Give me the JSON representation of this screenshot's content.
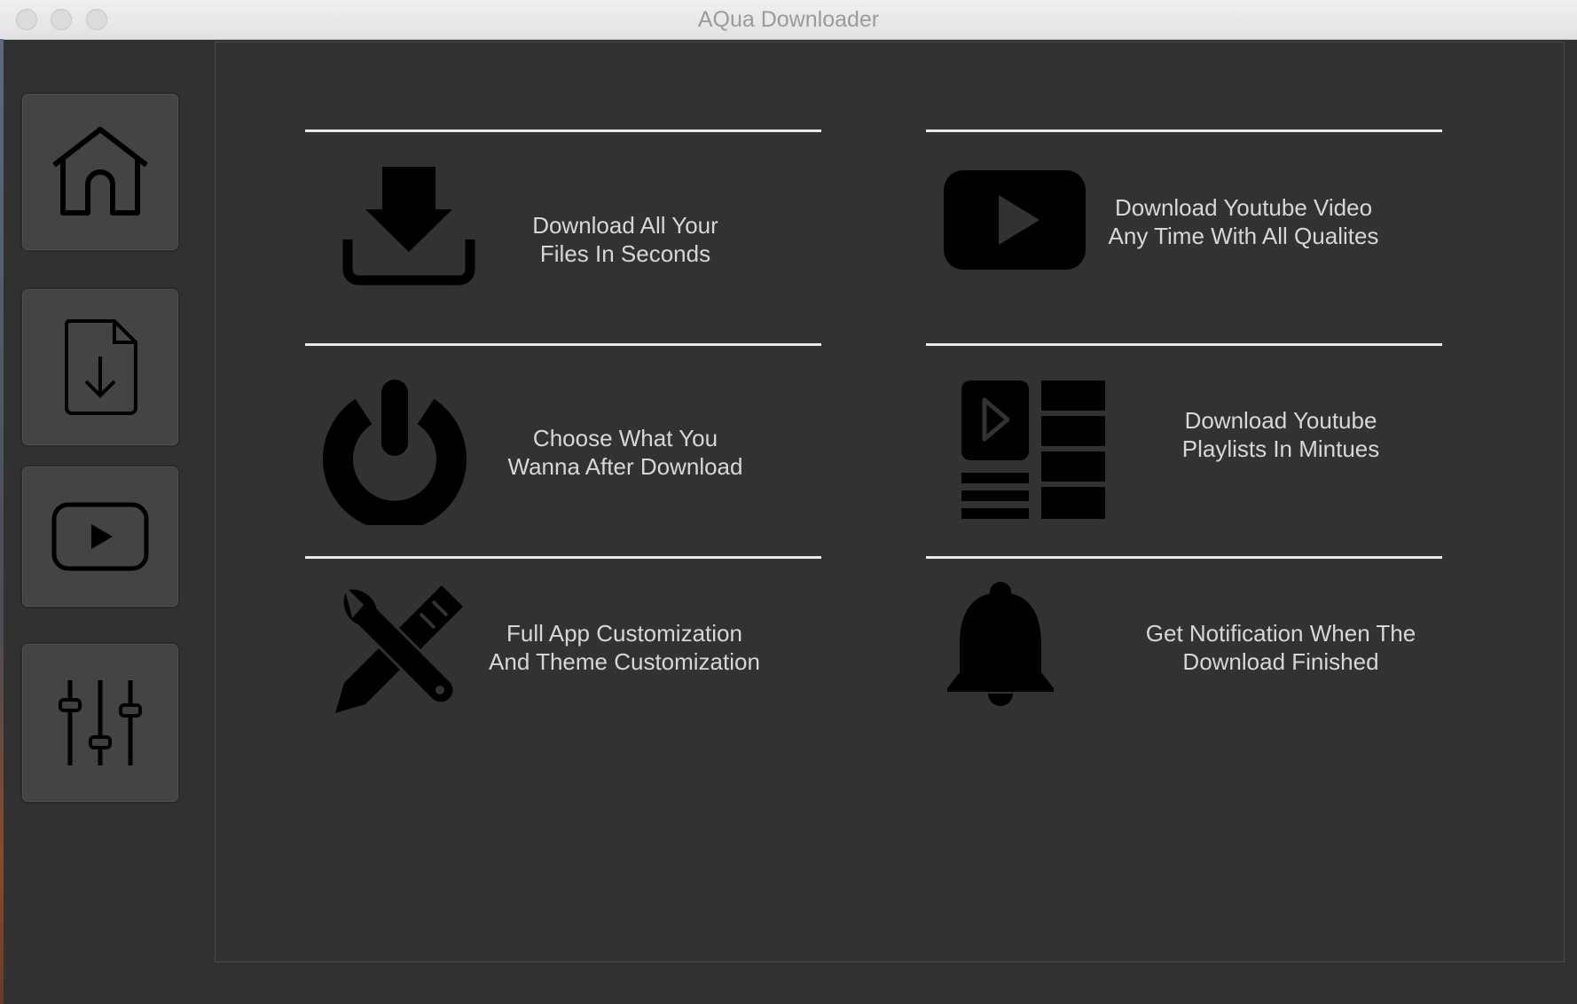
{
  "window": {
    "title": "AQua Downloader"
  },
  "sidebar": {
    "items": [
      {
        "name": "home",
        "icon": "home-icon"
      },
      {
        "name": "file-download",
        "icon": "file-download-icon"
      },
      {
        "name": "youtube",
        "icon": "play-video-icon"
      },
      {
        "name": "settings",
        "icon": "sliders-icon"
      }
    ]
  },
  "features": [
    {
      "icon": "download-tray-icon",
      "text": "Download All Your\nFiles In Seconds"
    },
    {
      "icon": "youtube-play-icon",
      "text": "Download Youtube Video\nAny Time With All Qualites"
    },
    {
      "icon": "power-icon",
      "text": "Choose What You\nWanna After Download"
    },
    {
      "icon": "playlist-icon",
      "text": "Download Youtube\nPlaylists In Mintues"
    },
    {
      "icon": "tools-icon",
      "text": "Full App Customization\nAnd Theme Customization"
    },
    {
      "icon": "bell-icon",
      "text": "Get Notification When The\nDownload Finished"
    }
  ],
  "colors": {
    "background": "#313131",
    "panel": "#444444",
    "text": "#d7d7d7",
    "divider": "#e9e9e9"
  }
}
